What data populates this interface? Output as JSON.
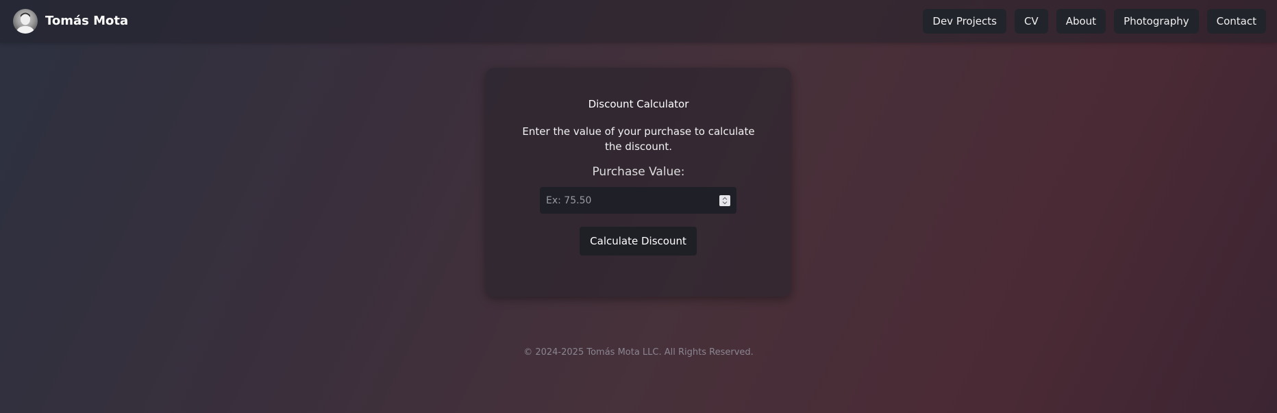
{
  "header": {
    "brand": "Tomás Mota",
    "avatar_icon": "person-avatar-icon",
    "nav": [
      {
        "label": "Dev Projects"
      },
      {
        "label": "CV"
      },
      {
        "label": "About"
      },
      {
        "label": "Photography"
      },
      {
        "label": "Contact"
      }
    ]
  },
  "calculator": {
    "title": "Discount Calculator",
    "description": "Enter the value of your purchase to calculate the discount.",
    "label": "Purchase Value:",
    "input_value": "",
    "placeholder": "Ex: 75.50",
    "spinner_icon": "number-spinner-icon",
    "button": "Calculate Discount"
  },
  "footer": {
    "copyright": "© 2024-2025 Tomás Mota LLC. All Rights Reserved."
  },
  "colors": {
    "nav_bg": "#22242c",
    "card_bg": "#2a2530",
    "input_bg": "#1f1f27",
    "button_bg": "#1f1f26"
  }
}
